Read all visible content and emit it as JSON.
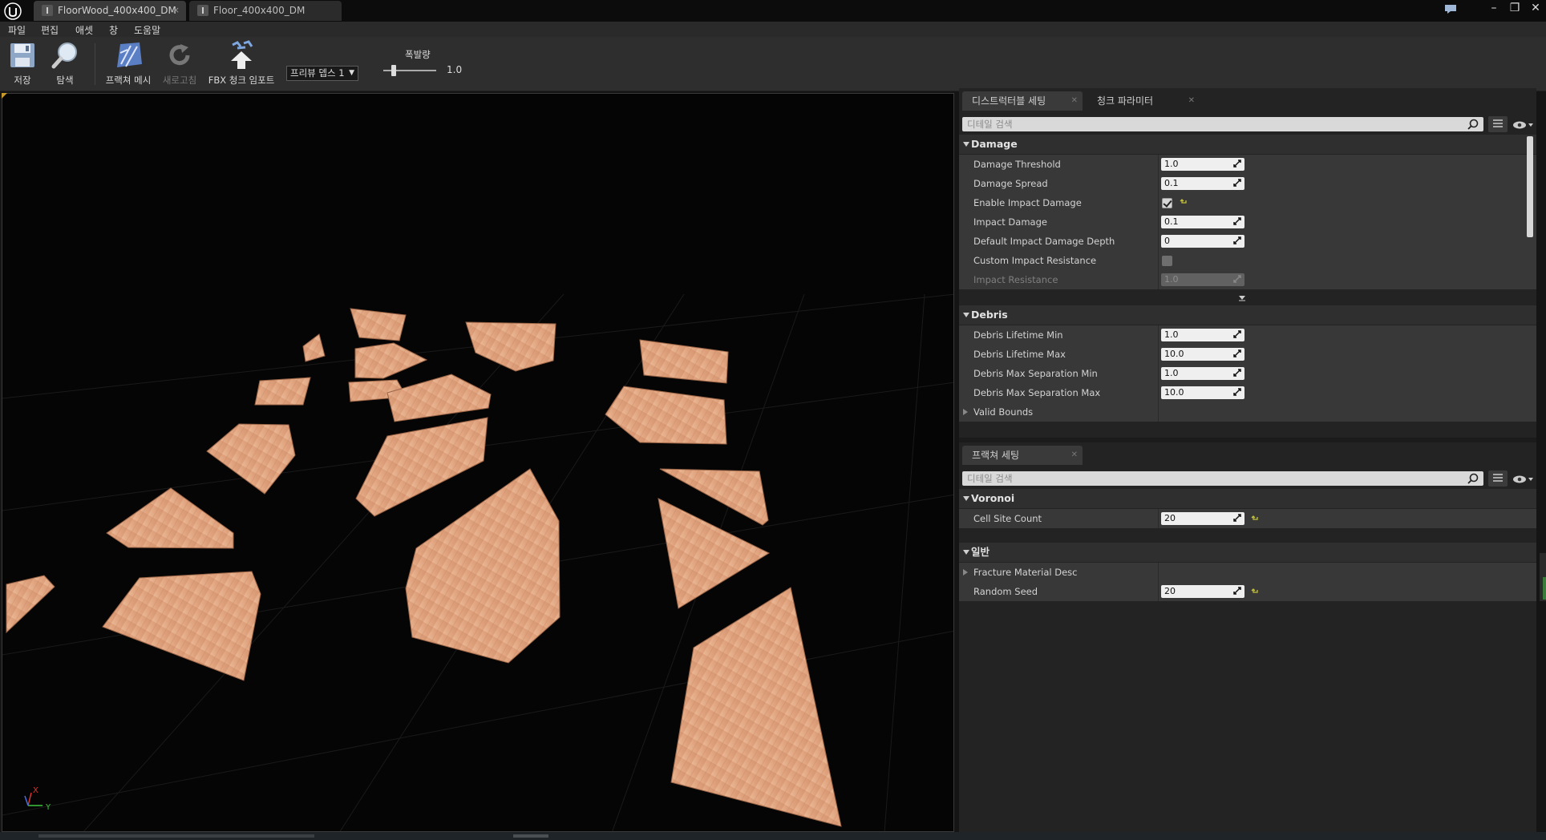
{
  "window": {
    "tabs": [
      {
        "label": "FloorWood_400x400_DM",
        "active": true
      },
      {
        "label": "Floor_400x400_DM",
        "active": false
      }
    ]
  },
  "menu": [
    "파일",
    "편집",
    "애셋",
    "창",
    "도움말"
  ],
  "toolbar": {
    "save": "저장",
    "browse": "탐색",
    "fracture_mesh": "프랙쳐 메시",
    "refresh": "새로고침",
    "fbx_chunk_import": "FBX 청크 임포트",
    "preview_depth": "프리뷰 뎁스 1",
    "explode_amount_label": "폭발량",
    "explode_amount_value": "1.0",
    "explode_fraction": 0.2
  },
  "viewport": {
    "axis_x": "X",
    "axis_y": "Y",
    "accent_color": "#c79a2a",
    "wood_color": "#e3a985"
  },
  "destructible_panel": {
    "tabs": [
      "디스트럭터블 세팅",
      "청크 파라미터"
    ],
    "search_placeholder": "디테일 검색",
    "damage": {
      "title": "Damage",
      "damage_threshold": {
        "label": "Damage Threshold",
        "value": "1.0"
      },
      "damage_spread": {
        "label": "Damage Spread",
        "value": "0.1"
      },
      "enable_impact_damage": {
        "label": "Enable Impact Damage",
        "checked": true
      },
      "impact_damage": {
        "label": "Impact Damage",
        "value": "0.1"
      },
      "default_impact_damage_depth": {
        "label": "Default Impact Damage Depth",
        "value": "0"
      },
      "custom_impact_resistance": {
        "label": "Custom Impact Resistance",
        "checked": false
      },
      "impact_resistance": {
        "label": "Impact Resistance",
        "value": "1.0"
      }
    },
    "debris": {
      "title": "Debris",
      "lifetime_min": {
        "label": "Debris Lifetime Min",
        "value": "1.0"
      },
      "lifetime_max": {
        "label": "Debris Lifetime Max",
        "value": "10.0"
      },
      "separation_min": {
        "label": "Debris Max Separation Min",
        "value": "1.0"
      },
      "separation_max": {
        "label": "Debris Max Separation Max",
        "value": "10.0"
      },
      "valid_bounds": {
        "label": "Valid Bounds"
      }
    }
  },
  "fracture_panel": {
    "tab": "프랙쳐 세팅",
    "search_placeholder": "디테일 검색",
    "voronoi": {
      "title": "Voronoi",
      "cell_site_count": {
        "label": "Cell Site Count",
        "value": "20"
      }
    },
    "general": {
      "title": "일반",
      "fracture_material_desc": {
        "label": "Fracture Material Desc"
      },
      "random_seed": {
        "label": "Random Seed",
        "value": "20"
      }
    }
  }
}
